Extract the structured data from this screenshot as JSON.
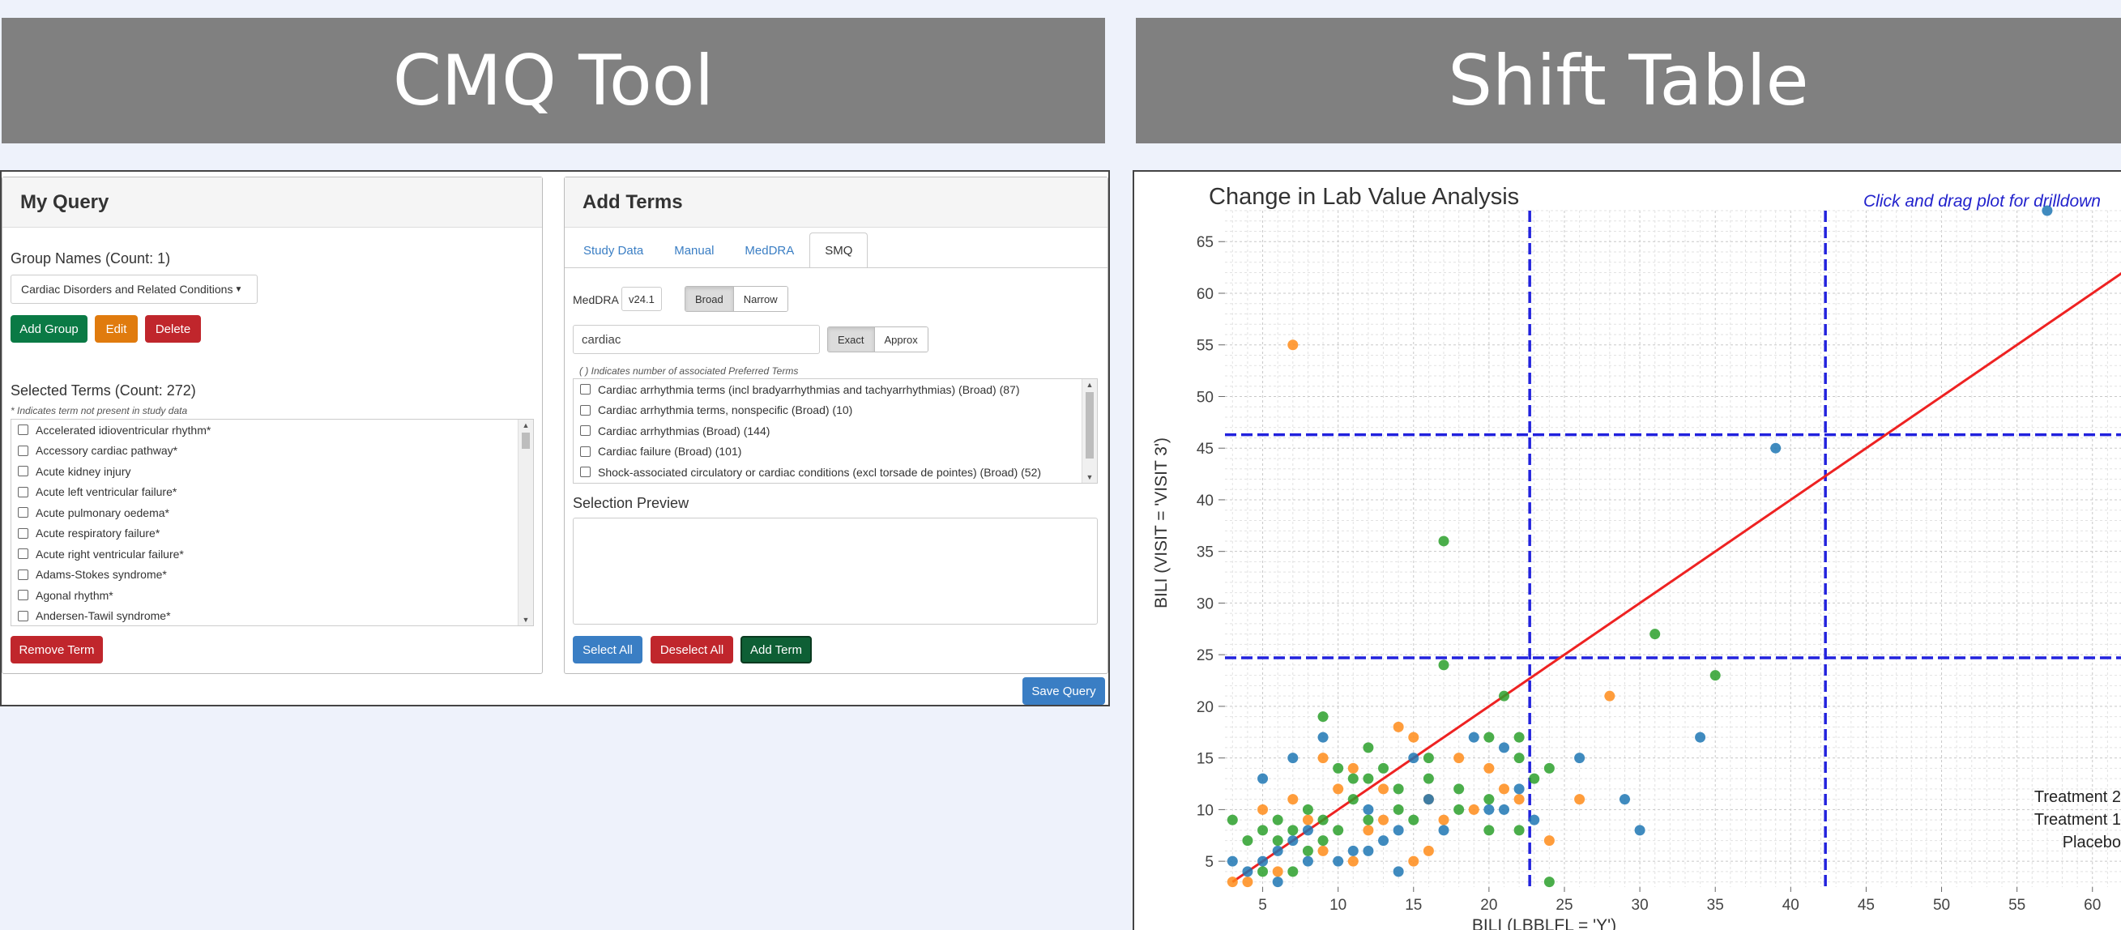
{
  "banners": {
    "left": "CMQ Tool",
    "right": "Shift Table"
  },
  "my_query": {
    "title": "My Query",
    "group_names_label": "Group Names (Count: 1)",
    "group_selected": "Cardiac Disorders and Related Conditions",
    "add_group": "Add Group",
    "edit": "Edit",
    "delete": "Delete",
    "selected_terms_label": "Selected Terms (Count: 272)",
    "selected_terms_note": "* Indicates term not present in study data",
    "terms": [
      "Accelerated idioventricular rhythm*",
      "Accessory cardiac pathway*",
      "Acute kidney injury",
      "Acute left ventricular failure*",
      "Acute pulmonary oedema*",
      "Acute respiratory failure*",
      "Acute right ventricular failure*",
      "Adams-Stokes syndrome*",
      "Agonal rhythm*",
      "Andersen-Tawil syndrome*"
    ],
    "remove_term": "Remove Term",
    "save_query": "Save Query"
  },
  "add_terms": {
    "title": "Add Terms",
    "tabs": [
      "Study Data",
      "Manual",
      "MedDRA",
      "SMQ"
    ],
    "active_tab": "SMQ",
    "meddra_label": "MedDRA",
    "meddra_version": "v24.1",
    "scope_options": [
      "Broad",
      "Narrow"
    ],
    "scope_selected": "Broad",
    "search_value": "cardiac",
    "match_options": [
      "Exact",
      "Approx"
    ],
    "match_selected": "Exact",
    "smq_note": "( ) Indicates number of associated Preferred Terms",
    "smq_items": [
      "Cardiac arrhythmia terms (incl bradyarrhythmias and tachyarrhythmias) (Broad) (87)",
      "Cardiac arrhythmia terms, nonspecific (Broad) (10)",
      "Cardiac arrhythmias (Broad) (144)",
      "Cardiac failure (Broad) (101)",
      "Shock-associated circulatory or cardiac conditions (excl torsade de pointes) (Broad) (52)"
    ],
    "selection_preview_label": "Selection Preview",
    "select_all": "Select All",
    "deselect_all": "Deselect All",
    "add_term": "Add Term"
  },
  "chart_data": {
    "type": "scatter",
    "title": "Change in Lab Value Analysis",
    "hint": "Click and drag plot for drilldown",
    "xlabel": "BILI (LBBLFL = 'Y')",
    "ylabel": "BILI (VISIT = 'VISIT 3')",
    "xlim": [
      2.5,
      62
    ],
    "ylim": [
      2.5,
      68
    ],
    "xticks": [
      5,
      10,
      15,
      20,
      25,
      30,
      35,
      40,
      45,
      50,
      55,
      60
    ],
    "yticks": [
      5,
      10,
      15,
      20,
      25,
      30,
      35,
      40,
      45,
      50,
      55,
      60,
      65
    ],
    "grid": true,
    "legend_position": "bottom-right",
    "reference_line": {
      "from": [
        3,
        3
      ],
      "to": [
        62,
        62
      ],
      "color": "#ee2222"
    },
    "threshold_lines": {
      "x": [
        22.7,
        42.3
      ],
      "y": [
        24.7,
        46.3
      ],
      "color": "#2222dd"
    },
    "series": [
      {
        "name": "Treatment 2",
        "color": "#2ca02c",
        "points": [
          [
            3,
            9
          ],
          [
            4,
            7
          ],
          [
            5,
            8
          ],
          [
            6,
            7
          ],
          [
            6,
            9
          ],
          [
            7,
            8
          ],
          [
            8,
            10
          ],
          [
            8,
            6
          ],
          [
            9,
            9
          ],
          [
            9,
            19
          ],
          [
            10,
            8
          ],
          [
            11,
            11
          ],
          [
            12,
            9
          ],
          [
            12,
            16
          ],
          [
            13,
            14
          ],
          [
            14,
            10
          ],
          [
            15,
            9
          ],
          [
            16,
            15
          ],
          [
            17,
            36
          ],
          [
            17,
            24
          ],
          [
            18,
            10
          ],
          [
            20,
            11
          ],
          [
            20,
            17
          ],
          [
            21,
            21
          ],
          [
            22,
            8
          ],
          [
            22,
            15
          ],
          [
            23,
            13
          ],
          [
            24,
            14
          ],
          [
            24,
            3
          ],
          [
            31,
            27
          ],
          [
            35,
            23
          ],
          [
            12,
            13
          ],
          [
            10,
            14
          ],
          [
            14,
            12
          ],
          [
            9,
            7
          ],
          [
            11,
            13
          ],
          [
            22,
            17
          ],
          [
            7,
            4
          ],
          [
            5,
            4
          ],
          [
            16,
            13
          ],
          [
            18,
            12
          ],
          [
            20,
            8
          ]
        ]
      },
      {
        "name": "Treatment 1",
        "color": "#1f77b4",
        "points": [
          [
            3,
            5
          ],
          [
            4,
            4
          ],
          [
            5,
            13
          ],
          [
            5,
            5
          ],
          [
            6,
            6
          ],
          [
            7,
            7
          ],
          [
            7,
            15
          ],
          [
            8,
            5
          ],
          [
            9,
            17
          ],
          [
            10,
            5
          ],
          [
            11,
            6
          ],
          [
            12,
            10
          ],
          [
            13,
            7
          ],
          [
            14,
            8
          ],
          [
            15,
            15
          ],
          [
            16,
            11
          ],
          [
            17,
            8
          ],
          [
            19,
            17
          ],
          [
            20,
            10
          ],
          [
            21,
            16
          ],
          [
            22,
            12
          ],
          [
            23,
            9
          ],
          [
            26,
            15
          ],
          [
            29,
            11
          ],
          [
            30,
            8
          ],
          [
            34,
            17
          ],
          [
            39,
            45
          ],
          [
            57,
            68
          ],
          [
            21,
            10
          ],
          [
            8,
            8
          ],
          [
            12,
            6
          ],
          [
            14,
            4
          ],
          [
            6,
            3
          ]
        ]
      },
      {
        "name": "Placebo",
        "color": "#ff8c1a",
        "points": [
          [
            3,
            3
          ],
          [
            4,
            3
          ],
          [
            5,
            10
          ],
          [
            6,
            4
          ],
          [
            7,
            55
          ],
          [
            7,
            11
          ],
          [
            8,
            9
          ],
          [
            9,
            15
          ],
          [
            10,
            12
          ],
          [
            11,
            5
          ],
          [
            12,
            8
          ],
          [
            13,
            12
          ],
          [
            14,
            18
          ],
          [
            15,
            17
          ],
          [
            16,
            11
          ],
          [
            17,
            9
          ],
          [
            18,
            15
          ],
          [
            19,
            10
          ],
          [
            20,
            14
          ],
          [
            21,
            12
          ],
          [
            22,
            11
          ],
          [
            24,
            7
          ],
          [
            26,
            11
          ],
          [
            28,
            21
          ],
          [
            15,
            5
          ],
          [
            11,
            14
          ],
          [
            9,
            6
          ],
          [
            13,
            9
          ],
          [
            16,
            6
          ]
        ]
      }
    ]
  }
}
